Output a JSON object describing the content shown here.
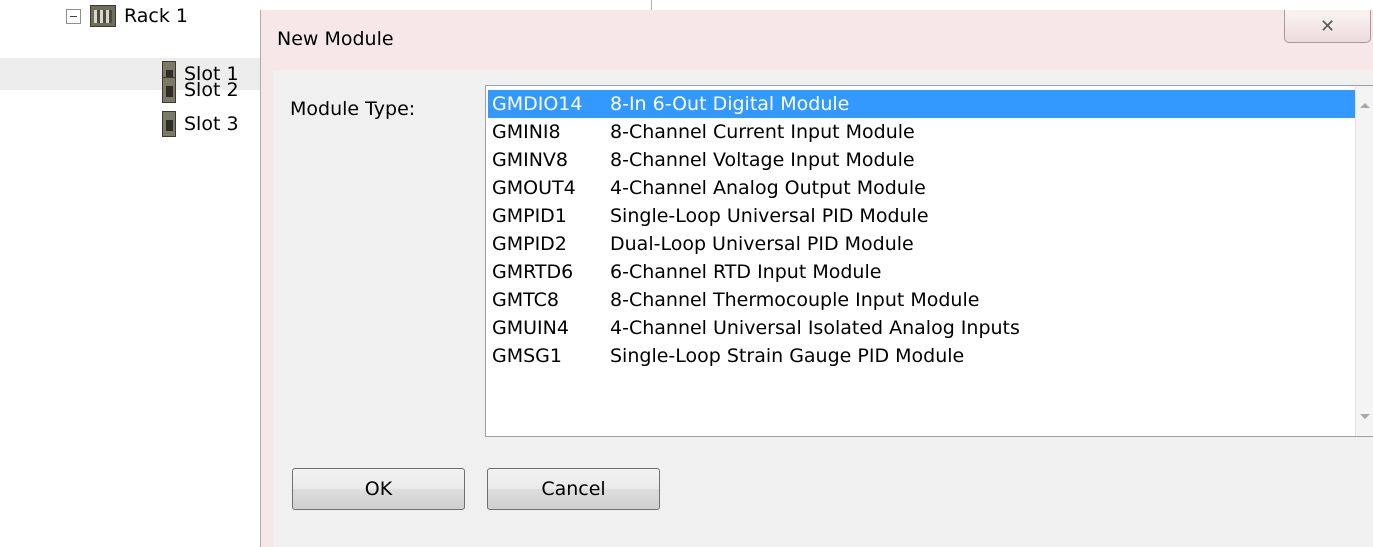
{
  "tree": {
    "rack_label": "Rack 1",
    "slots": [
      {
        "label": "Slot 1",
        "selected": true
      },
      {
        "label": "Slot 2",
        "selected": false
      },
      {
        "label": "Slot 3",
        "selected": false
      }
    ]
  },
  "dialog": {
    "title": "New Module",
    "close_glyph": "✕",
    "module_type_label": "Module Type:",
    "modules": [
      {
        "code": "GMDIO14",
        "description": "8-In 6-Out Digital Module",
        "selected": true
      },
      {
        "code": "GMINI8",
        "description": "8-Channel Current Input Module",
        "selected": false
      },
      {
        "code": "GMINV8",
        "description": "8-Channel Voltage Input Module",
        "selected": false
      },
      {
        "code": "GMOUT4",
        "description": "4-Channel Analog Output Module",
        "selected": false
      },
      {
        "code": "GMPID1",
        "description": "Single-Loop Universal PID Module",
        "selected": false
      },
      {
        "code": "GMPID2",
        "description": "Dual-Loop Universal PID Module",
        "selected": false
      },
      {
        "code": "GMRTD6",
        "description": "6-Channel RTD Input Module",
        "selected": false
      },
      {
        "code": "GMTC8",
        "description": "8-Channel Thermocouple Input Module",
        "selected": false
      },
      {
        "code": "GMUIN4",
        "description": "4-Channel Universal Isolated Analog Inputs",
        "selected": false
      },
      {
        "code": "GMSG1",
        "description": "Single-Loop Strain Gauge PID Module",
        "selected": false
      }
    ],
    "ok_label": "OK",
    "cancel_label": "Cancel"
  },
  "colors": {
    "selection": "#3399ff",
    "dialog_frame": "#f6e8e8",
    "client_area": "#f0f0f0"
  }
}
